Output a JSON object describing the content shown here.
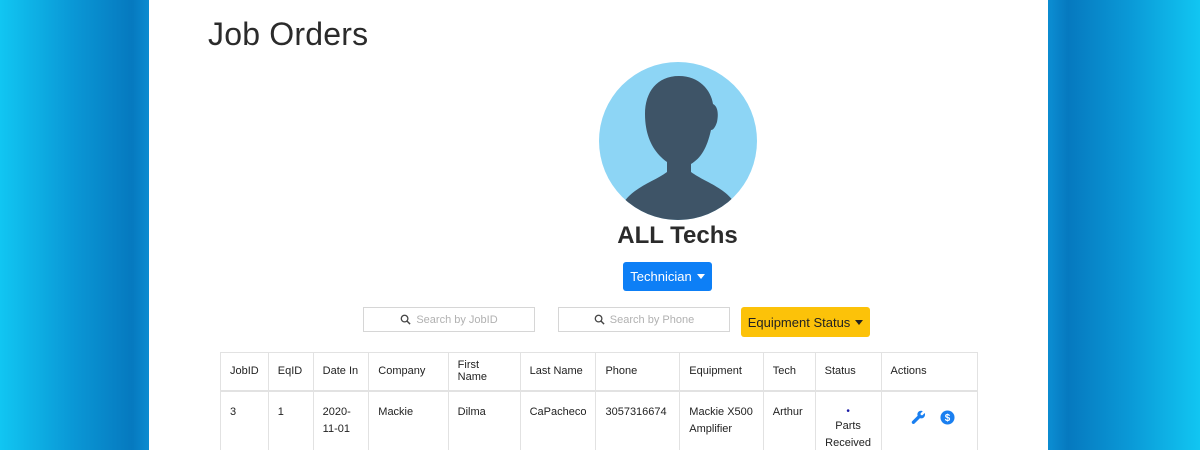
{
  "page": {
    "title": "Job Orders"
  },
  "profile": {
    "name": "ALL Techs",
    "avatar_icon": "person-silhouette-icon"
  },
  "controls": {
    "technician_button": "Technician",
    "search_jobid_placeholder": "Search by JobID",
    "search_phone_placeholder": "Search by Phone",
    "equipment_status_button": "Equipment Status"
  },
  "colors": {
    "primary": "#0d7ff6",
    "warning": "#fcc209",
    "avatar_bg": "#8dd5f5",
    "avatar_fg": "#3e5467"
  },
  "table": {
    "headers": [
      "JobID",
      "EqID",
      "Date In",
      "Company",
      "First Name",
      "Last Name",
      "Phone",
      "Equipment",
      "Tech",
      "Status",
      "Actions"
    ],
    "rows": [
      {
        "jobid": "3",
        "eqid": "1",
        "date_in": "2020-11-01",
        "company": "Mackie",
        "first_name": "Dilma",
        "last_name": "CaPacheco",
        "phone": "3057316674",
        "equipment": "Mackie X500 Amplifier",
        "tech": "Arthur",
        "status_bullet": "•",
        "status": "Parts Received",
        "action_icons": [
          "wrench-icon",
          "dollar-icon"
        ]
      }
    ]
  }
}
